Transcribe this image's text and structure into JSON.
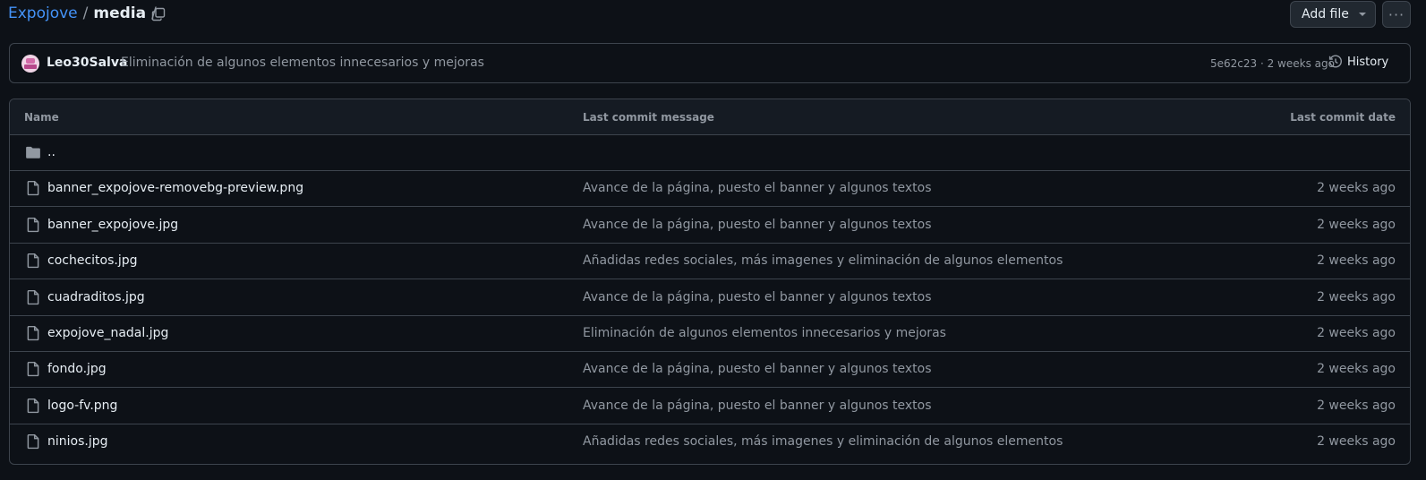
{
  "breadcrumb": {
    "repo": "Expojove",
    "sep1": "/",
    "folder": "media",
    "sep2": "/"
  },
  "actions": {
    "add_file": "Add file",
    "more": "···"
  },
  "latest_commit": {
    "author": "Leo30Salva",
    "message": "Eliminación de algunos elementos innecesarios y mejoras",
    "meta": "5e62c23 · 2 weeks ago",
    "history_label": "History"
  },
  "table": {
    "headers": {
      "name": "Name",
      "message": "Last commit message",
      "date": "Last commit date"
    },
    "parent_dir": "..",
    "rows": [
      {
        "name": "banner_expojove-removebg-preview.png",
        "message": "Avance de la página, puesto el banner y algunos textos",
        "date": "2 weeks ago"
      },
      {
        "name": "banner_expojove.jpg",
        "message": "Avance de la página, puesto el banner y algunos textos",
        "date": "2 weeks ago"
      },
      {
        "name": "cochecitos.jpg",
        "message": "Añadidas redes sociales, más imagenes y eliminación de algunos elementos",
        "date": "2 weeks ago"
      },
      {
        "name": "cuadraditos.jpg",
        "message": "Avance de la página, puesto el banner y algunos textos",
        "date": "2 weeks ago"
      },
      {
        "name": "expojove_nadal.jpg",
        "message": "Eliminación de algunos elementos innecesarios y mejoras",
        "date": "2 weeks ago"
      },
      {
        "name": "fondo.jpg",
        "message": "Avance de la página, puesto el banner y algunos textos",
        "date": "2 weeks ago"
      },
      {
        "name": "logo-fv.png",
        "message": "Avance de la página, puesto el banner y algunos textos",
        "date": "2 weeks ago"
      },
      {
        "name": "ninios.jpg",
        "message": "Añadidas redes sociales, más imagenes y eliminación de algunos elementos",
        "date": "2 weeks ago"
      }
    ]
  },
  "colors": {
    "background": "#0d1117",
    "link": "#4493f8",
    "border": "#3d444d",
    "muted": "#9198a1",
    "text": "#e6edf3"
  },
  "icons": {
    "copy": "copy-icon",
    "history": "history-icon",
    "folder": "folder-icon",
    "file": "file-icon",
    "caret": "triangle-down-icon",
    "more": "kebab-horizontal-icon"
  }
}
